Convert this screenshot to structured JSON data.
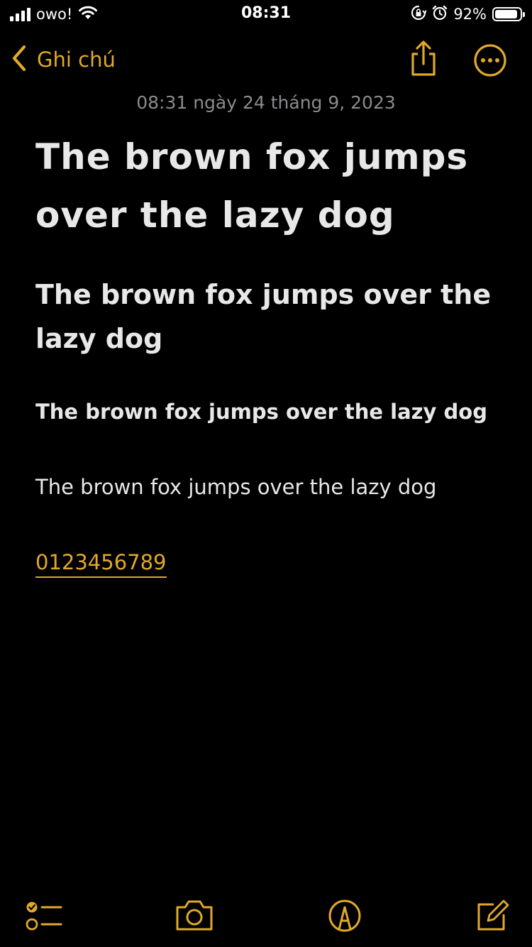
{
  "status_bar": {
    "carrier": "owo!",
    "time": "08:31",
    "battery_percent": "92%",
    "battery_level": 0.92,
    "icons": [
      "signal-icon",
      "wifi-icon",
      "orientation-lock-icon",
      "alarm-icon",
      "battery-icon"
    ]
  },
  "nav": {
    "back_label": "Ghi chú",
    "icons": [
      "chevron-left-icon",
      "share-icon",
      "more-icon"
    ]
  },
  "note": {
    "date": "08:31 ngày 24 tháng 9, 2023",
    "title": "The brown fox jumps over the lazy dog",
    "heading": "The brown fox jumps over the lazy dog",
    "subheading": "The brown fox jumps over the lazy dog",
    "body": "The brown fox jumps over the lazy dog",
    "link": "0123456789"
  },
  "toolbar": {
    "icons": [
      "checklist-icon",
      "camera-icon",
      "markup-icon",
      "compose-icon"
    ]
  },
  "colors": {
    "accent": "#e0a92a",
    "background": "#000000",
    "text": "#e8e8e8",
    "secondary_text": "#8b8b8e"
  }
}
